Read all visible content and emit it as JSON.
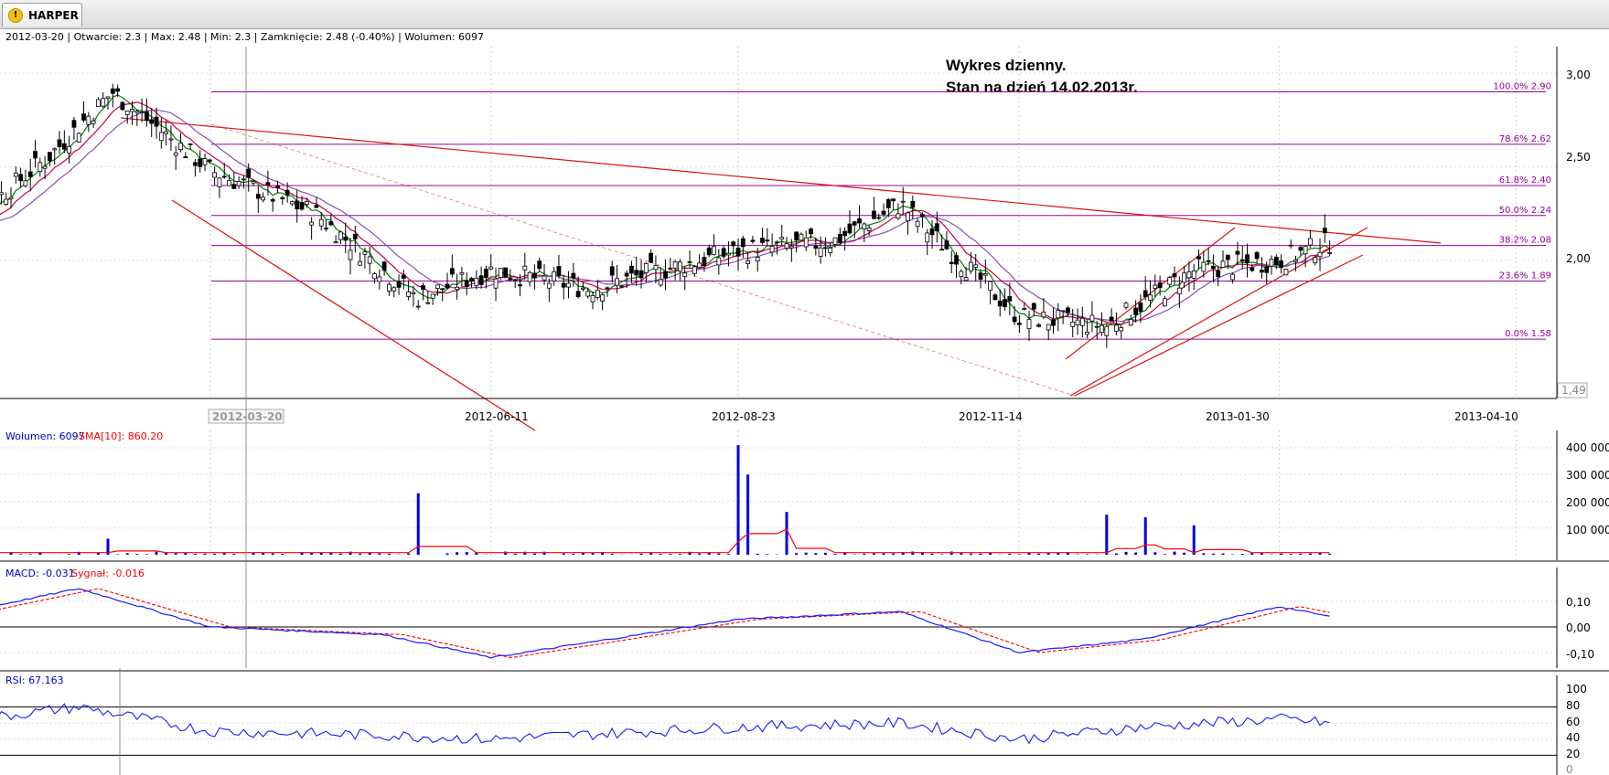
{
  "window": {
    "tab_label": "HARPER",
    "tab_icon": "warning-icon"
  },
  "price_panel": {
    "info_line": "2012-03-20 | Otwarcie: 2.3 | Max: 2.48 | Min: 2.3 | Zamknięcie: 2.48 (-0.40%)  | Wolumen: 6097",
    "annotation_line1": "Wykres dzienny.",
    "annotation_line2": "Stan na dzień 14.02.2013r.",
    "y_ticks": [
      "3,00",
      "2,50",
      "2,00"
    ],
    "y_min_label": "1,49",
    "x_ticks": [
      "2012-06-11",
      "2012-08-23",
      "2012-11-14",
      "2013-01-30",
      "2013-04-10"
    ],
    "cursor_date": "2012-03-20",
    "fib_levels": [
      {
        "label": "100.0% 2.90",
        "value": 2.9
      },
      {
        "label": "78.6% 2.62",
        "value": 2.62
      },
      {
        "label": "61.8% 2.40",
        "value": 2.4
      },
      {
        "label": "50.0% 2.24",
        "value": 2.24
      },
      {
        "label": "38.2% 2.08",
        "value": 2.08
      },
      {
        "label": "23.6% 1.89",
        "value": 1.89
      },
      {
        "label": "0.0% 1.58",
        "value": 1.58
      }
    ]
  },
  "volume_panel": {
    "label": "Wolumen: 6097",
    "sma_label": "SMA[10]: 860.20",
    "y_ticks": [
      "400 000",
      "300 000",
      "200 000",
      "100 000"
    ]
  },
  "macd_panel": {
    "label": "MACD: -0.031",
    "signal_label": "Sygnał: -0.016",
    "y_ticks": [
      "0,10",
      "0,00",
      "-0,10"
    ]
  },
  "rsi_panel": {
    "label": "RSI: 67.163",
    "y_ticks": [
      "100",
      "80",
      "60",
      "40",
      "20",
      "0"
    ]
  },
  "colors": {
    "candle": "#000000",
    "ma_fast": "#008000",
    "ma_mid": "#cc0044",
    "ma_slow": "#8a4fb3",
    "trendline": "#e01010",
    "fib": "#990099",
    "volume_bar": "#0000dd",
    "sma": "#ff0000",
    "macd": "#1a1aff",
    "signal": "#ff0000",
    "rsi": "#1a1aff"
  },
  "chart_data": [
    {
      "type": "candlestick",
      "title": "Wykres dzienny.",
      "ylim": [
        1.49,
        3.1
      ],
      "x_range": [
        "2012-01-01",
        "2013-04-20"
      ],
      "series": [
        {
          "x": [
            "2012-01-01",
            "2012-02-01",
            "2012-02-20",
            "2012-03-20",
            "2012-04-20",
            "2012-05-20",
            "2012-06-11",
            "2012-07-10",
            "2012-08-23",
            "2012-09-20",
            "2012-10-10",
            "2012-11-14",
            "2012-12-10",
            "2013-01-05",
            "2013-01-30",
            "2013-02-14"
          ],
          "close": [
            2.1,
            2.55,
            2.9,
            2.48,
            2.25,
            1.8,
            1.95,
            1.85,
            2.05,
            2.1,
            2.3,
            1.7,
            1.65,
            1.95,
            2.0,
            2.1
          ]
        }
      ]
    },
    {
      "type": "bar",
      "title": "",
      "ylim": [
        0,
        420000
      ],
      "series": [
        {
          "x": [
            "2012-02-20",
            "2012-05-20",
            "2012-08-23",
            "2012-08-25",
            "2012-09-05",
            "2012-12-10",
            "2012-12-20",
            "2013-01-05"
          ],
          "values": [
            60000,
            230000,
            410000,
            300000,
            160000,
            150000,
            140000,
            110000
          ]
        }
      ]
    },
    {
      "type": "line",
      "title": "",
      "ylim": [
        -0.15,
        0.15
      ],
      "series": [
        {
          "x": [
            "2012-01-01",
            "2012-02-10",
            "2012-03-20",
            "2012-05-10",
            "2012-06-11",
            "2012-08-23",
            "2012-10-10",
            "2012-11-14",
            "2012-12-20",
            "2013-01-30",
            "2013-02-14"
          ],
          "values": [
            0.04,
            0.15,
            0.0,
            -0.03,
            -0.12,
            0.03,
            0.06,
            -0.1,
            -0.05,
            0.08,
            0.04
          ]
        }
      ]
    },
    {
      "type": "line",
      "title": "",
      "ylim": [
        0,
        100
      ],
      "series": [
        {
          "x": [
            "2012-01-01",
            "2012-02-10",
            "2012-03-20",
            "2012-05-10",
            "2012-06-11",
            "2012-08-23",
            "2012-10-10",
            "2012-11-14",
            "2012-12-20",
            "2013-01-30",
            "2013-02-14"
          ],
          "values": [
            60,
            80,
            50,
            45,
            40,
            55,
            60,
            40,
            55,
            65,
            60
          ]
        }
      ]
    }
  ]
}
